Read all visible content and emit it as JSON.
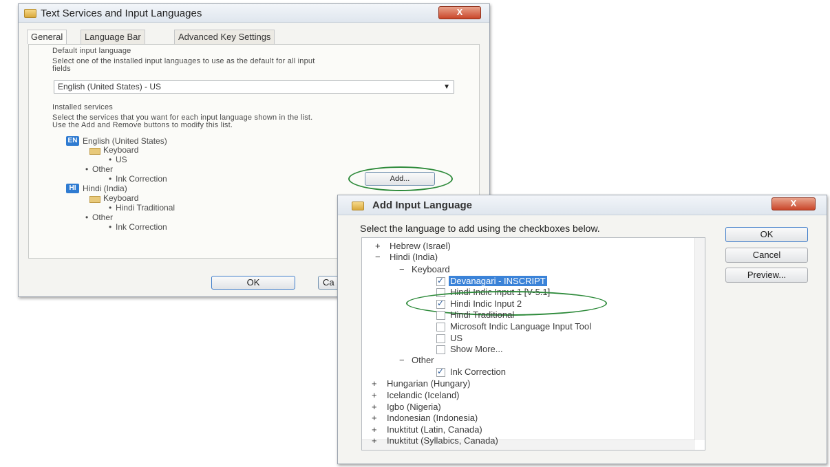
{
  "main_window": {
    "title": "Text Services and Input Languages",
    "close_label": "X",
    "tabs": [
      "General",
      "Language Bar",
      "Advanced Key Settings"
    ],
    "default_section": {
      "heading": "Default input language",
      "description_line1": "Select one of the installed input languages to use as the default for all input",
      "description_line2": "fields",
      "selected": "English (United States) - US"
    },
    "installed_section": {
      "heading": "Installed services",
      "description_line1": "Select the services that you want for each input language shown in the list.",
      "description_line2": "Use the Add and Remove buttons to modify this list."
    },
    "tree": {
      "english_badge": "EN",
      "english": "English (United States)",
      "english_keyboard": "Keyboard",
      "english_us": "US",
      "english_other": "Other",
      "english_ink": "Ink Correction",
      "hindi_badge": "HI",
      "hindi": "Hindi (India)",
      "hindi_keyboard": "Keyboard",
      "hindi_traditional": "Hindi Traditional",
      "hindi_other": "Other",
      "hindi_ink": "Ink Correction"
    },
    "add_button": "Add...",
    "ok_button": "OK",
    "cancel_button_partial": "Ca"
  },
  "dialog": {
    "title": "Add Input Language",
    "close_label": "X",
    "instruction": "Select the language to add using the checkboxes below.",
    "ok_button": "OK",
    "cancel_button": "Cancel",
    "preview_button": "Preview...",
    "rows": {
      "hebrew": "Hebrew (Israel)",
      "hindi": "Hindi (India)",
      "keyboard": "Keyboard",
      "devanagari": "Devanagari - INSCRIPT",
      "indic1": "Hindi Indic Input 1 [V-5.1]",
      "indic2": "Hindi Indic Input 2",
      "traditional": "Hindi Traditional",
      "microsoft_indic": "Microsoft Indic Language Input Tool",
      "us": "US",
      "show_more": "Show More...",
      "other": "Other",
      "ink": "Ink Correction",
      "hungarian": "Hungarian (Hungary)",
      "icelandic": "Icelandic (Iceland)",
      "igbo": "Igbo (Nigeria)",
      "indonesian": "Indonesian (Indonesia)",
      "inuktitut_latin": "Inuktitut (Latin, Canada)",
      "inuktitut_syllabics": "Inuktitut (Syllabics, Canada)"
    },
    "expanders": {
      "plus": "+",
      "minus": "−"
    },
    "checked": {
      "devanagari": true,
      "indic1": false,
      "indic2": true,
      "traditional": false,
      "microsoft_indic": false,
      "us": false,
      "show_more": false,
      "ink": true
    }
  },
  "colors": {
    "selection": "#3b83d8",
    "annotation_ring": "#2d8a3a",
    "title_close": "#c9462a"
  }
}
